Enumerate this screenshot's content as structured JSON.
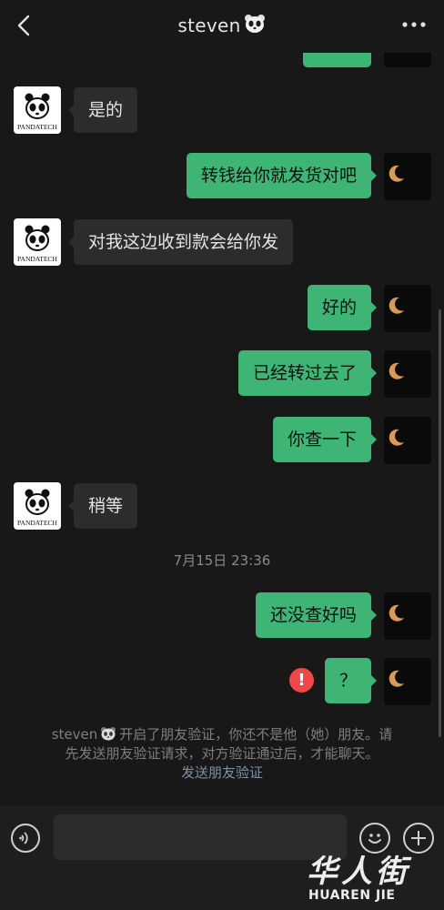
{
  "header": {
    "title": "steven",
    "back_icon": "chevron-left-icon",
    "more_icon": "more-dots-icon"
  },
  "contact": {
    "avatar_text": "PANDATECH"
  },
  "messages": [
    {
      "from": "other",
      "text": "是的"
    },
    {
      "from": "me",
      "text": "转钱给你就发货对吧"
    },
    {
      "from": "other",
      "text": "对我这边收到款会给你发"
    },
    {
      "from": "me",
      "text": "好的"
    },
    {
      "from": "me",
      "text": "已经转过去了"
    },
    {
      "from": "me",
      "text": "你查一下"
    },
    {
      "from": "other",
      "text": "稍等"
    },
    {
      "from": "me",
      "text": "还没查好吗"
    },
    {
      "from": "me",
      "text": "？",
      "status": "failed"
    }
  ],
  "timestamp": "7月15日 23:36",
  "system_note": {
    "name": "steven",
    "line1": "开启了朋友验证，你还不是他（她）朋友。请",
    "line2": "先发送朋友验证请求，对方验证通过后，才能聊天。",
    "link": "发送朋友验证"
  },
  "input_bar": {
    "voice_icon": "voice-icon",
    "emoji_icon": "emoji-icon",
    "plus_icon": "plus-icon",
    "value": ""
  },
  "watermark": {
    "latin": "HUAREN",
    "tail": "JIE",
    "chinese": "华人街"
  },
  "colors": {
    "background": "#181818",
    "my_bubble": "#3eb575",
    "other_bubble": "#2c2c2c",
    "alert": "#f04848",
    "link": "#7d90a9"
  }
}
